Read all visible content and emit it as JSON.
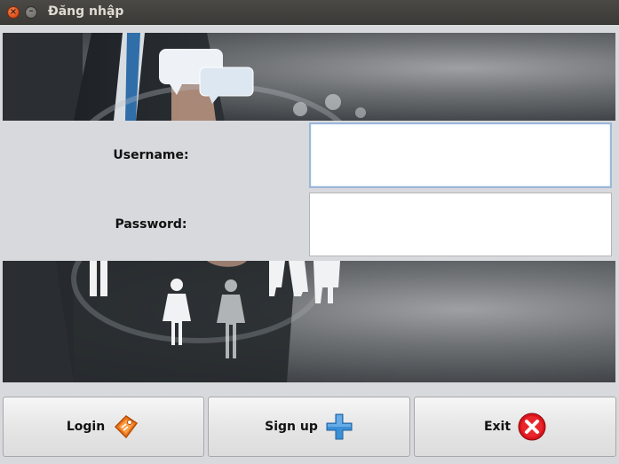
{
  "window": {
    "title": "Đăng nhập"
  },
  "form": {
    "username_label": "Username:",
    "password_label": "Password:",
    "username_value": "",
    "password_value": ""
  },
  "buttons": {
    "login_label": "Login",
    "signup_label": "Sign up",
    "exit_label": "Exit"
  },
  "icons": {
    "login": "key-tag-icon",
    "signup": "plus-icon",
    "exit": "close-circle-icon"
  },
  "colors": {
    "titlebar": "#3f3e3b",
    "close_button": "#e2541f",
    "exit_icon": "#d9141b",
    "plus_icon": "#3a8fd6",
    "login_icon": "#f07818"
  }
}
